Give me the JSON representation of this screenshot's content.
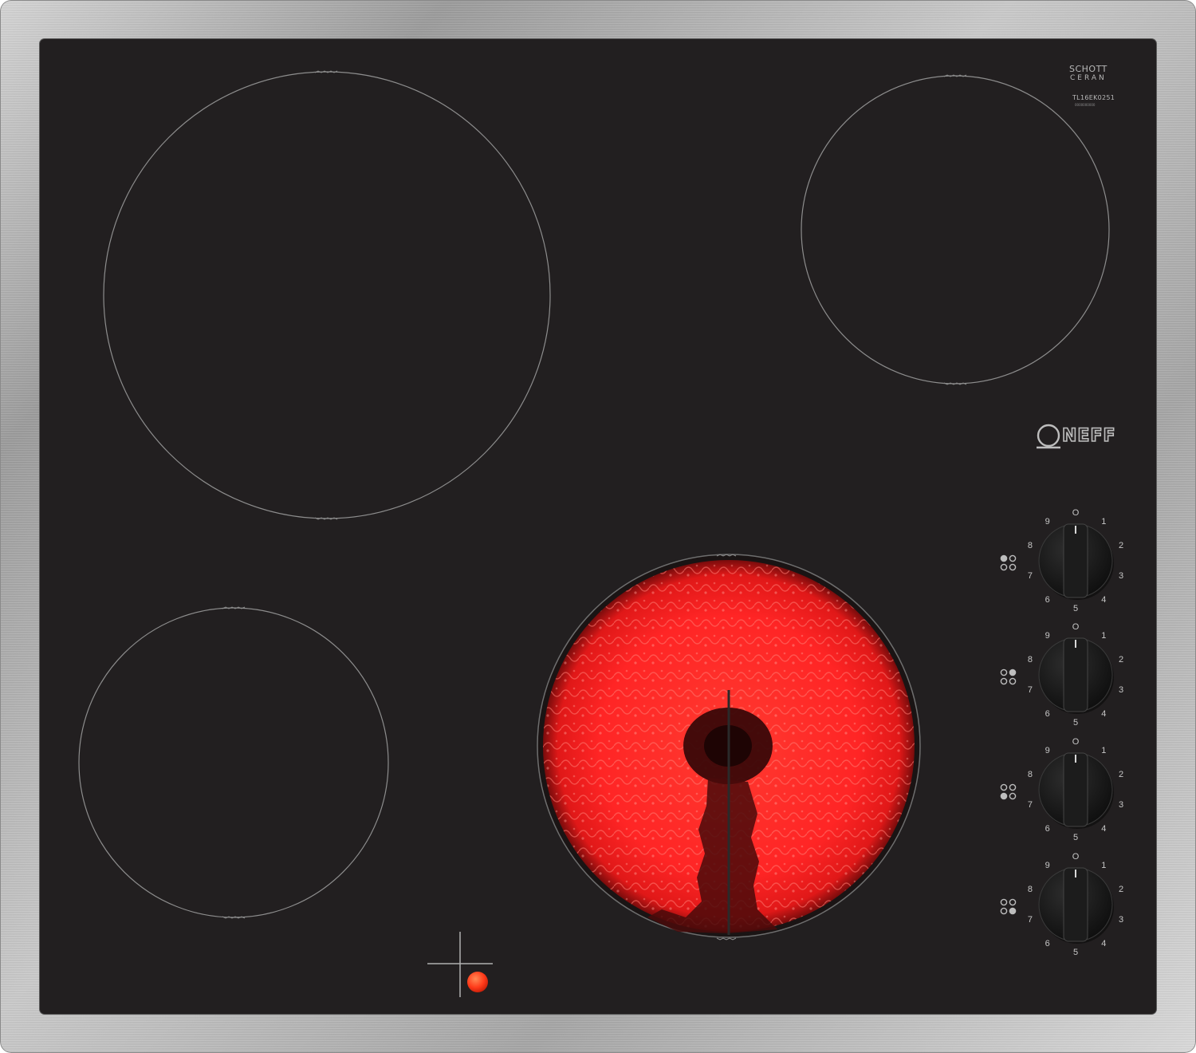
{
  "product": {
    "brand_logo_text": "NEFF",
    "glass_brand_line1": "SCHOTT",
    "glass_brand_line2": "CERAN",
    "glass_model_line1": "TL16EK0251",
    "glass_model_line2": "0000000000"
  },
  "colors": {
    "frame": "#b3b3b3",
    "glass": "#221f20",
    "ring": "#8d8d8d",
    "hot_zone": "#ff2a2a",
    "indicator": "#ff3b1a",
    "knob": "#161616"
  },
  "hob": {
    "zones": [
      {
        "name": "rear-left",
        "active": false
      },
      {
        "name": "rear-right",
        "active": false
      },
      {
        "name": "front-left",
        "active": false
      },
      {
        "name": "front-right",
        "active": true
      }
    ],
    "residual_heat_indicator": {
      "icon": "cross-indicator-icon",
      "on": true
    }
  },
  "controls": {
    "dial_labels": {
      "off": "O",
      "settings": [
        "1",
        "2",
        "3",
        "4",
        "5",
        "6",
        "7",
        "8",
        "9"
      ]
    },
    "knobs": [
      {
        "zone": "rear-left",
        "position_icon": "zone-position-icon",
        "setting": "0"
      },
      {
        "zone": "rear-right",
        "position_icon": "zone-position-icon",
        "setting": "0"
      },
      {
        "zone": "front-left",
        "position_icon": "zone-position-icon",
        "setting": "0"
      },
      {
        "zone": "front-right",
        "position_icon": "zone-position-icon",
        "setting": "0"
      }
    ]
  }
}
